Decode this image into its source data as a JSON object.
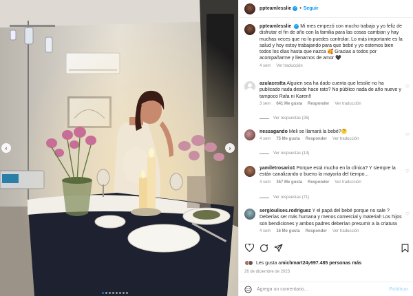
{
  "post": {
    "username": "ppteamlesslie",
    "follow_label": "Seguir",
    "caption": "Mi mes empezó con mucho trabajo y yo feliz de disfrutar el fin de año con la familia para las cosas cambian y hay muchas veces que no lo puedes controlar. Lo más importante es la salud y hoy estoy trabajando para que bebé y yo estemos bien todos los días hasta que nazca 🥰 Gracias a todos por acompañarme y llenarnos de amor 🖤",
    "caption_time": "4 sem",
    "caption_translate": "Ver traducción"
  },
  "comments": [
    {
      "user": "azulacestta",
      "text": "Alguien sea ha dado cuenta que lesslie no ha publicado nada desde hace rato? No público nada de año nuevo y tampoco Rafa ni Karen!!",
      "time": "3 sem",
      "likes": "641 Me gusta",
      "reply": "Responder",
      "translate": "Ver traducción",
      "replies": "Ver respuestas (26)"
    },
    {
      "user": "nessagando",
      "text": "Meli se llamará la bebé?🤔",
      "time": "4 sem",
      "likes": "75 Me gusta",
      "reply": "Responder",
      "translate": "Ver traducción",
      "replies": "Ver respuestas (14)"
    },
    {
      "user": "yamiletrosario1",
      "text": "Porque está mucho en la clínica? Y siempre la están canalizando o bueno la mayoría del tiempo...",
      "time": "4 sem",
      "likes": "357 Me gusta",
      "reply": "Responder",
      "translate": "Ver traducción",
      "replies": "Ver respuestas (71)"
    },
    {
      "user": "sergioulises.rodriguez",
      "text": "Y el papá del bebé porque no sale ? Deberías ser más humana y menos comercial y material! Los hijos son bendiciones y ambos padres deberían presumir a la criatura",
      "time": "4 sem",
      "likes": "16 Me gusta",
      "reply": "Responder",
      "translate": "Ver traducción",
      "replies": ""
    }
  ],
  "likes_line": {
    "prefix": "Les gusta a ",
    "user": "michmart24",
    "middle": " y ",
    "count": "697.485 personas más"
  },
  "date": "26 de diciembre de 2023",
  "add_comment": {
    "placeholder": "Agrega un comentario...",
    "publish": "Publicar"
  },
  "icons": [
    "heart-icon",
    "comment-icon",
    "share-icon",
    "save-icon",
    "smile-icon",
    "chevron-left-icon",
    "chevron-right-icon"
  ],
  "colors": {
    "link": "#0095f6",
    "muted": "#8e8e8e",
    "verified": "#1d9bf0"
  }
}
